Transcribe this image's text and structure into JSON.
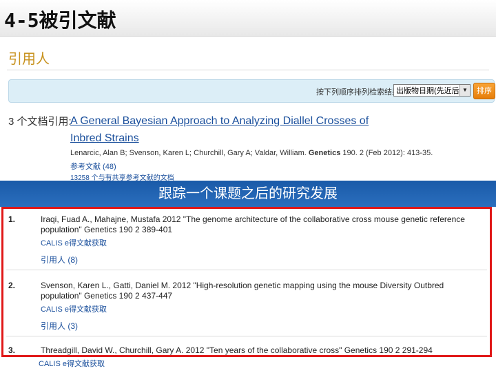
{
  "slide": {
    "title": "4-5被引文献"
  },
  "section": {
    "heading": "引用人"
  },
  "sort": {
    "label": "按下列顺序排列检索结果:",
    "selected": "出版物日期(先近后远)",
    "button": "排序"
  },
  "article": {
    "count_label": "3 个文档引用:",
    "title": "A General Bayesian Approach to Analyzing Diallel Crosses of Inbred Strains",
    "authors": "Lenarcic, Alan B; Svenson, Karen L; Churchill, Gary A; Valdar, William.",
    "journal": "Genetics",
    "citation": "190. 2 (Feb 2012): 413-35.",
    "refs_label": "参考文献 (48)",
    "shared_label": "13258 个与有共享参考文献的文档"
  },
  "banner": {
    "text": "跟踪一个课题之后的研究发展"
  },
  "results": [
    {
      "num": "1.",
      "text": "Iraqi, Fuad A., Mahajne, Mustafa 2012 \"The genome architecture of the collaborative cross mouse genetic reference population\" Genetics 190 2 389-401",
      "calis": "CALIS e得文献获取",
      "cited": "引用人 (8)"
    },
    {
      "num": "2.",
      "text": "Svenson, Karen L., Gatti, Daniel M. 2012 \"High-resolution genetic mapping using the mouse Diversity Outbred population\" Genetics 190 2 437-447",
      "calis": "CALIS e得文献获取",
      "cited": "引用人 (3)"
    },
    {
      "num": "3.",
      "text": "Threadgill, David W., Churchill, Gary A. 2012 \"Ten years of the collaborative cross\" Genetics 190 2 291-294",
      "calis": "CALIS e得文献获取"
    }
  ],
  "colors": {
    "link": "#1a4f9c",
    "heading": "#c8921e",
    "banner": "#1a5aa8",
    "highlight_border": "#e01818",
    "sort_button": "#f39322"
  }
}
